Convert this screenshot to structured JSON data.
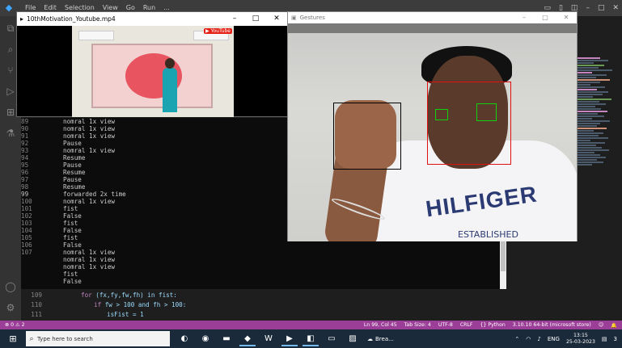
{
  "vscode": {
    "menu": [
      "File",
      "Edit",
      "Selection",
      "View",
      "Go",
      "Run",
      "..."
    ],
    "terminal_lines": [
      {
        "num": "89",
        "text": "nomral 1x view"
      },
      {
        "num": "90",
        "text": "nomral 1x view"
      },
      {
        "num": "91",
        "text": "nomral 1x view"
      },
      {
        "num": "92",
        "text": "Pause"
      },
      {
        "num": "93",
        "text": "nomral 1x view"
      },
      {
        "num": "94",
        "text": "Resume"
      },
      {
        "num": "95",
        "text": "Pause"
      },
      {
        "num": "96",
        "text": "Resume"
      },
      {
        "num": "97",
        "text": "Pause"
      },
      {
        "num": "98",
        "text": "Resume"
      },
      {
        "num": "99",
        "text": "forwarded 2x time"
      },
      {
        "num": "100",
        "text": "nomral 1x view"
      },
      {
        "num": "101",
        "text": "fist"
      },
      {
        "num": "102",
        "text": "False"
      },
      {
        "num": "103",
        "text": "fist"
      },
      {
        "num": "104",
        "text": "False"
      },
      {
        "num": "105",
        "text": "fist"
      },
      {
        "num": "106",
        "text": "False"
      },
      {
        "num": "107",
        "text": "nomral 1x view"
      },
      {
        "num": "",
        "text": "nomral 1x view"
      },
      {
        "num": "",
        "text": "nomral 1x view"
      },
      {
        "num": "",
        "text": "fist"
      },
      {
        "num": "",
        "text": "False"
      }
    ],
    "code_lines": [
      {
        "num": "109",
        "kw": "for",
        "rest": " (fx,fy,fw,fh) in fist:"
      },
      {
        "num": "110",
        "kw": "if",
        "rest": " fw > 100 and fh > 100:"
      },
      {
        "num": "111",
        "kw": "",
        "rest": "isFist = 1"
      }
    ],
    "statusbar": {
      "errors": "⊗ 0 ⚠ 2",
      "ln_col": "Ln 99, Col 45",
      "tab_size": "Tab Size: 4",
      "encoding": "UTF-8",
      "eol": "CRLF",
      "language": "{} Python",
      "interpreter": "3.10.10 64-bit (microsoft store)"
    }
  },
  "video_window": {
    "title": "10thMotivation_Youtube.mp4",
    "badge": "▶ YouTube"
  },
  "gestures_window": {
    "title": "Gestures",
    "shirt_text": "HILFIGER",
    "shirt_sub": "ESTABLISHED"
  },
  "taskbar": {
    "search_placeholder": "Type here to search",
    "weather": "Brea...",
    "lang": "ENG",
    "time": "13:15",
    "date": "25-03-2023",
    "notification_count": "3"
  }
}
